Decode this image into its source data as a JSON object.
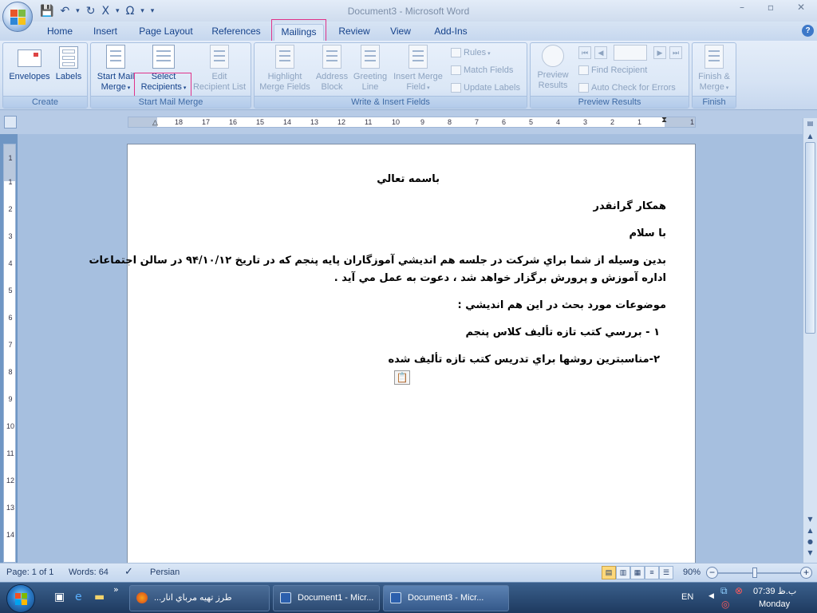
{
  "window": {
    "title": "Document3 - Microsoft Word"
  },
  "qat": {
    "save": "💾",
    "undo": "↶",
    "redo": "↻",
    "subscript": "X",
    "omega": "Ω",
    "more": "▾"
  },
  "tabs": [
    "Home",
    "Insert",
    "Page Layout",
    "References",
    "Mailings",
    "Review",
    "View",
    "Add-Ins"
  ],
  "ribbon": {
    "create": {
      "label": "Create",
      "envelopes": "Envelopes",
      "labels": "Labels"
    },
    "start_mail_merge": {
      "label": "Start Mail Merge",
      "start_line1": "Start Mail",
      "start_line2": "Merge",
      "select_line1": "Select",
      "select_line2": "Recipients",
      "edit_line1": "Edit",
      "edit_line2": "Recipient List"
    },
    "write_insert": {
      "label": "Write & Insert Fields",
      "highlight_line1": "Highlight",
      "highlight_line2": "Merge Fields",
      "address_line1": "Address",
      "address_line2": "Block",
      "greeting_line1": "Greeting",
      "greeting_line2": "Line",
      "insert_line1": "Insert Merge",
      "insert_line2": "Field",
      "rules": "Rules",
      "match_fields": "Match Fields",
      "update_labels": "Update Labels"
    },
    "preview": {
      "label": "Preview Results",
      "preview_line1": "Preview",
      "preview_line2": "Results",
      "find_recipient": "Find Recipient",
      "auto_check": "Auto Check for Errors"
    },
    "finish": {
      "label": "Finish",
      "line1": "Finish &",
      "line2": "Merge"
    }
  },
  "ruler": {
    "h_labels": [
      "18",
      "17",
      "16",
      "15",
      "14",
      "13",
      "12",
      "11",
      "10",
      "9",
      "8",
      "7",
      "6",
      "5",
      "4",
      "3",
      "2",
      "1",
      "1"
    ],
    "v_labels": [
      "1",
      "1",
      "2",
      "3",
      "4",
      "5",
      "6",
      "7",
      "8",
      "9",
      "10",
      "11",
      "12",
      "13",
      "14"
    ]
  },
  "document": {
    "lines": [
      "باسمه تعالي",
      "همكار گرانقدر",
      "با سلام",
      "بدين وسيله از شما براي شركت در جلسه هم انديشي آموزگاران پايه پنجم كه در تاريخ ۹۴/۱۰/۱۲ در سالن اجتماعات",
      "اداره آموزش و پرورش برگزار خواهد شد ، دعوت به عمل مي آيد .",
      "موضوعات مورد بحث در اين هم انديشي :",
      "۱ - بررسي كتب تازه تأليف كلاس پنجم",
      "۲-مناسبترين روشها براي تدريس كتب تازه تأليف شده"
    ]
  },
  "statusbar": {
    "page": "Page: 1 of 1",
    "words": "Words: 64",
    "language": "Persian",
    "zoom": "90%"
  },
  "taskbar": {
    "tasks": [
      "...طرز تهيه مرباي انار",
      "Document1 - Micr...",
      "Document3 - Micr..."
    ],
    "lang": "EN",
    "time": "07:39 ب.ظ",
    "day": "Monday"
  },
  "colors": {
    "highlight_box": "#e0338a",
    "ribbon_text": "#15428b",
    "disabled_text": "#8da3c0"
  }
}
